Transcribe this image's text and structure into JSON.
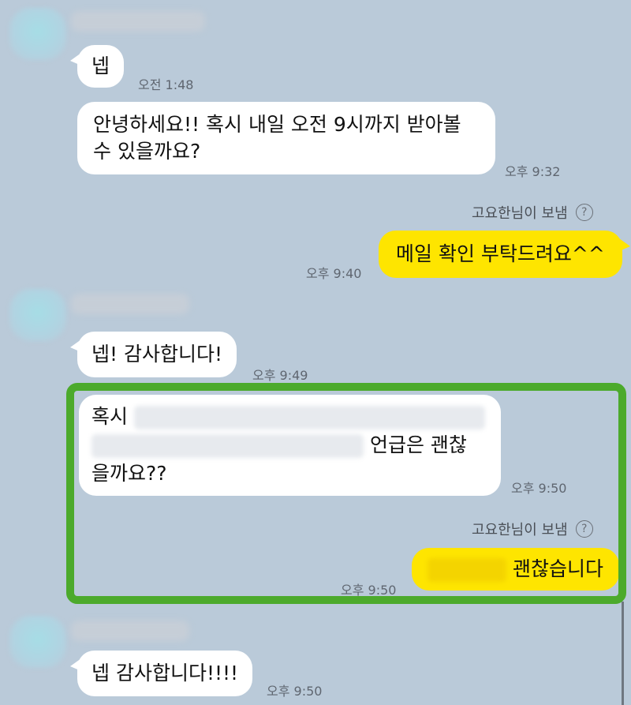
{
  "status_text": "고요한님이 보냄",
  "status_icon": "question-circle-icon",
  "messages": [
    {
      "text": "넵",
      "time": "오전 1:48"
    },
    {
      "text": "안녕하세요!! 혹시 내일 오전 9시까지 받아볼 수 있을까요?",
      "time": "오후 9:32"
    },
    {
      "text": "메일 확인 부탁드려요^^",
      "time": "오후 9:40"
    },
    {
      "text": "넵! 감사합니다!",
      "time": "오후 9:49"
    },
    {
      "prefix": "혹시",
      "mid": "언급은 괜찮",
      "suffix": "을까요??",
      "time": "오후 9:50"
    },
    {
      "text": "괜찮습니다",
      "time": "오후 9:50"
    },
    {
      "text": "넵 감사합니다!!!!",
      "time": "오후 9:50"
    }
  ],
  "colors": {
    "background": "#bacad9",
    "incoming_bubble": "#ffffff",
    "outgoing_bubble": "#fee500",
    "highlight_border": "#4caa2c"
  }
}
